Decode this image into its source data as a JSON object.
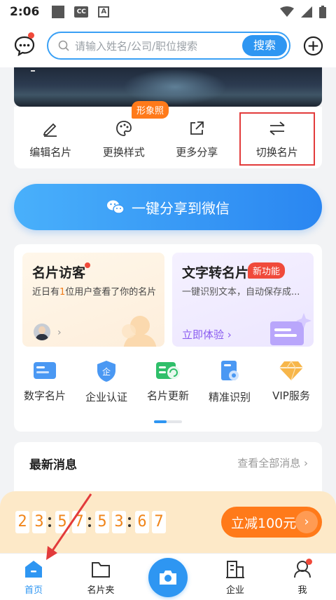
{
  "status_bar": {
    "time": "2:06",
    "icon_cc": "CC",
    "icon_a": "A"
  },
  "header": {
    "search_placeholder": "请输入姓名/公司/职位搜索",
    "search_button": "搜索"
  },
  "card_actions": [
    {
      "label": "编辑名片",
      "icon": "pencil-icon"
    },
    {
      "label": "更换样式",
      "icon": "palette-icon",
      "badge": "形象照"
    },
    {
      "label": "更多分享",
      "icon": "share-icon"
    },
    {
      "label": "切换名片",
      "icon": "switch-icon",
      "highlighted": true
    }
  ],
  "share_button": "一键分享到微信",
  "visitors": {
    "title": "名片访客",
    "desc_prefix": "近日有",
    "desc_count": "1",
    "desc_suffix": "位用户查看了你的名片"
  },
  "text_to_card": {
    "title": "文字转名片",
    "badge": "新功能",
    "desc": "一键识别文本，自动保存成...",
    "action": "立即体验"
  },
  "services": [
    {
      "label": "数字名片",
      "icon": "digital-card-icon",
      "color": "#3b8ef5"
    },
    {
      "label": "企业认证",
      "icon": "enterprise-shield-icon",
      "color": "#2f7de8"
    },
    {
      "label": "名片更新",
      "icon": "card-refresh-icon",
      "color": "#2fbf6a"
    },
    {
      "label": "精准识别",
      "icon": "scan-icon",
      "color": "#2e86e8"
    },
    {
      "label": "VIP服务",
      "icon": "vip-diamond-icon",
      "color": "#f5a623"
    }
  ],
  "news": {
    "title": "最新消息",
    "more": "查看全部消息"
  },
  "promo": {
    "countdown": [
      "2",
      "3",
      "5",
      "7",
      "5",
      "3",
      "6",
      "7"
    ],
    "button": "立减100元"
  },
  "nav": [
    {
      "label": "首页",
      "icon": "home-icon",
      "active": true
    },
    {
      "label": "名片夹",
      "icon": "folder-icon"
    },
    {
      "label": "",
      "icon": "camera-icon"
    },
    {
      "label": "企业",
      "icon": "building-icon"
    },
    {
      "label": "我",
      "icon": "profile-icon"
    }
  ],
  "colors": {
    "accent": "#2e96f2",
    "orange": "#ff7a1a",
    "red": "#f04a3a",
    "promo_bg": "#fde9c8"
  }
}
